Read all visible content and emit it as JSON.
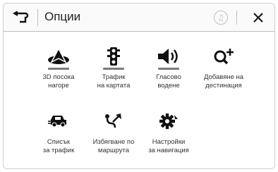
{
  "header": {
    "title": "Опции",
    "music_icon": "♫"
  },
  "options_row1": [
    {
      "label": "3D посока\nнагоре",
      "icon": "navigation-arrow-icon"
    },
    {
      "label": "Трафик\nна картата",
      "icon": "traffic-light-icon"
    },
    {
      "label": "Гласово\nводене",
      "icon": "speaker-icon"
    },
    {
      "label": "Добавяне на\nдестинация",
      "icon": "add-destination-icon"
    }
  ],
  "options_row2": [
    {
      "label": "Списък\nза трафик",
      "icon": "traffic-list-icon"
    },
    {
      "label": "Избягване по\nмаршрута",
      "icon": "route-avoid-icon"
    },
    {
      "label": "Настройки\nза навигация",
      "icon": "navigation-settings-icon"
    }
  ]
}
